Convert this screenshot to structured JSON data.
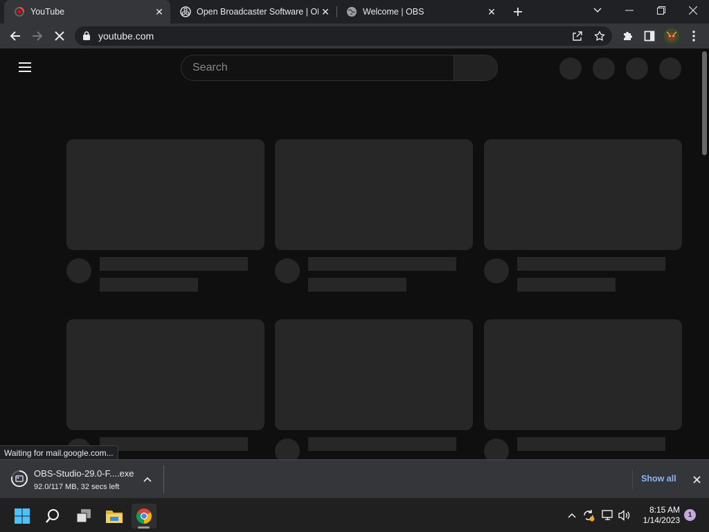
{
  "tabs": [
    {
      "title": "YouTube",
      "favicon": "youtube-loading-icon",
      "active": true
    },
    {
      "title": "Open Broadcaster Software | OBS",
      "favicon": "obs-icon",
      "active": false
    },
    {
      "title": "Welcome | OBS",
      "favicon": "globe-icon",
      "active": false
    }
  ],
  "omnibox": {
    "url": "youtube.com"
  },
  "youtube": {
    "search_placeholder": "Search"
  },
  "status_bubble": "Waiting for mail.google.com...",
  "download": {
    "filename": "OBS-Studio-29.0-F....exe",
    "status": "92.0/117 MB, 32 secs left",
    "progress_fraction": 0.786,
    "show_all": "Show all"
  },
  "taskbar": {
    "time": "8:15 AM",
    "date": "1/14/2023",
    "notification_count": "1"
  },
  "colors": {
    "page_bg": "#0f0f0f",
    "skeleton": "#272727",
    "link_blue": "#8ab4f8"
  }
}
